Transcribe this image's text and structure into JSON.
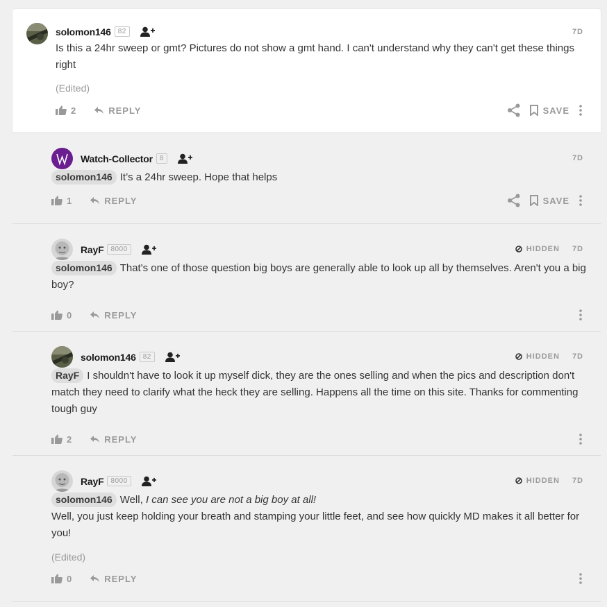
{
  "comments": [
    {
      "username": "solomon146",
      "score": "82",
      "time": "7D",
      "hidden_label": "",
      "mention": "",
      "text": "Is this a 24hr sweep or gmt? Pictures do not show a gmt hand. I can't understand why they can't get these things right",
      "edited": "(Edited)",
      "likes": "2",
      "reply_label": "REPLY",
      "save_label": "SAVE"
    },
    {
      "username": "Watch-Collector",
      "score": "8",
      "time": "7D",
      "mention": "solomon146",
      "text": "It’s a 24hr sweep. Hope that helps",
      "likes": "1",
      "reply_label": "REPLY",
      "save_label": "SAVE"
    },
    {
      "username": "RayF",
      "score": "8000",
      "time": "7D",
      "hidden_label": "HIDDEN",
      "mention": "solomon146",
      "text": "That's one of those question big boys are generally able to look up all by themselves. Aren't you a big boy?",
      "likes": "0",
      "reply_label": "REPLY"
    },
    {
      "username": "solomon146",
      "score": "82",
      "time": "7D",
      "hidden_label": "HIDDEN",
      "mention": "RayF",
      "text": "I shouldn't have to look it up myself dick, they are the ones selling and when the pics and description don't match they need to clarify what the heck they are selling. Happens all the time on this site. Thanks for commenting tough guy",
      "likes": "2",
      "reply_label": "REPLY"
    },
    {
      "username": "RayF",
      "score": "8000",
      "time": "7D",
      "hidden_label": "HIDDEN",
      "mention": "solomon146",
      "text_prefix": "Well, ",
      "text_italic": "I can see you are not a big boy at all!",
      "text_line2": "Well, you just keep holding your breath and stamping your little feet, and see how quickly MD makes it all better for you!",
      "edited": "(Edited)",
      "likes": "0",
      "reply_label": "REPLY"
    }
  ],
  "colors": {
    "icon_gray": "#999999",
    "dark_icon": "#222222",
    "wc_avatar": "#6b1e8f"
  },
  "icons": [
    "thumbs-up-icon",
    "reply-arrow-icon",
    "share-icon",
    "bookmark-icon",
    "more-vertical-icon",
    "follow-user-icon",
    "hidden-icon"
  ]
}
